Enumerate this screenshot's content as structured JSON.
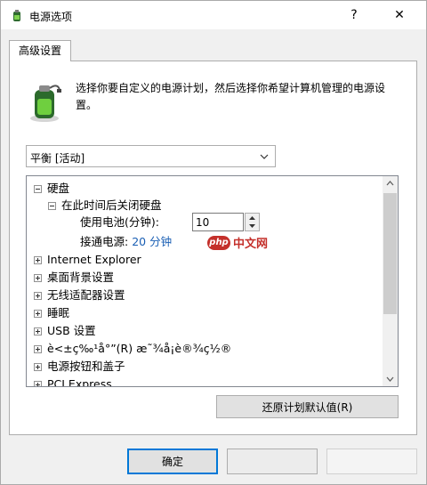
{
  "window": {
    "title": "电源选项",
    "help_label": "?",
    "close_label": "✕"
  },
  "tab": {
    "label": "高级设置"
  },
  "description": "选择你要自定义的电源计划，然后选择你希望计算机管理的电源设置。",
  "plan_select": {
    "value": "平衡 [活动]"
  },
  "tree": {
    "harddisk": "硬盘",
    "turn_off": "在此时间后关闭硬盘",
    "on_battery_label": "使用电池(分钟):",
    "on_battery_value": "10",
    "plugged_in_label": "接通电源:",
    "plugged_in_value": "20 分钟",
    "items": [
      "Internet Explorer",
      "桌面背景设置",
      "无线适配器设置",
      "睡眠",
      "USB 设置",
      "è<±ç‰¹å°”(R) æ˜¾å¡è®¾ç½®",
      "电源按钮和盖子",
      "PCI Express"
    ]
  },
  "buttons": {
    "restore": "还原计划默认值(R)",
    "ok": "确定"
  },
  "watermark": {
    "badge": "php",
    "text": "中文网"
  },
  "colors": {
    "accent": "#0078d7",
    "link": "#1a5fb4",
    "watermark": "#c4302b"
  }
}
